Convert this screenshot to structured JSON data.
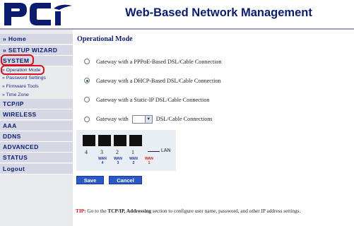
{
  "header": {
    "logo_text": "PCi",
    "title": "Web-Based Network Management"
  },
  "sidebar": {
    "items": [
      {
        "label": "» Home"
      },
      {
        "label": "» SETUP WIZARD"
      },
      {
        "label": "SYSTEM",
        "highlighted": true
      },
      {
        "label": "TCP/IP"
      },
      {
        "label": "WIRELESS"
      },
      {
        "label": "AAA"
      },
      {
        "label": "DDNS"
      },
      {
        "label": "ADVANCED"
      },
      {
        "label": "STATUS"
      },
      {
        "label": "Logout"
      }
    ],
    "subitems": [
      {
        "label": "» Operation Mode",
        "highlighted": true
      },
      {
        "label": "» Password Settings"
      },
      {
        "label": "» Firmware Tools"
      },
      {
        "label": "» Time Zone"
      }
    ]
  },
  "main": {
    "title": "Operational Mode",
    "options": [
      {
        "label": "Gateway with a PPPoE-Based DSL/Cable Connection",
        "checked": false
      },
      {
        "label": "Gateway with a DHCP-Based DSL/Cable Connection",
        "checked": true
      },
      {
        "label": "Gateway with a Static-IP DSL/Cable Connection",
        "checked": false
      },
      {
        "label_prefix": "Gateway with",
        "label_suffix": "DSL/Cable Connections",
        "select_value": "",
        "checked": false
      }
    ],
    "ports": {
      "numbers": [
        "4",
        "3",
        "2",
        "1"
      ],
      "lan_label": "LAN",
      "wan_labels": [
        {
          "text": "WAN",
          "num": "4",
          "color": "#1530a6"
        },
        {
          "text": "WAN",
          "num": "3",
          "color": "#1530a6"
        },
        {
          "text": "WAN",
          "num": "2",
          "color": "#1530a6"
        },
        {
          "text": "WAN",
          "num": "1",
          "color": "#d8121c"
        }
      ]
    },
    "buttons": {
      "save": "Save",
      "cancel": "Cancel"
    },
    "tip": {
      "label": "TIP:",
      "part1": " Go to the ",
      "bold": "TCP/IP, Addressing",
      "part2": " section to configure user name, password, and other IP address settings."
    }
  },
  "colors": {
    "title_navy": "#0b1c6e",
    "highlight_red": "#d8121c",
    "button_blue": "#2b58c9",
    "sidebar_bar": "#d5d8e4"
  }
}
